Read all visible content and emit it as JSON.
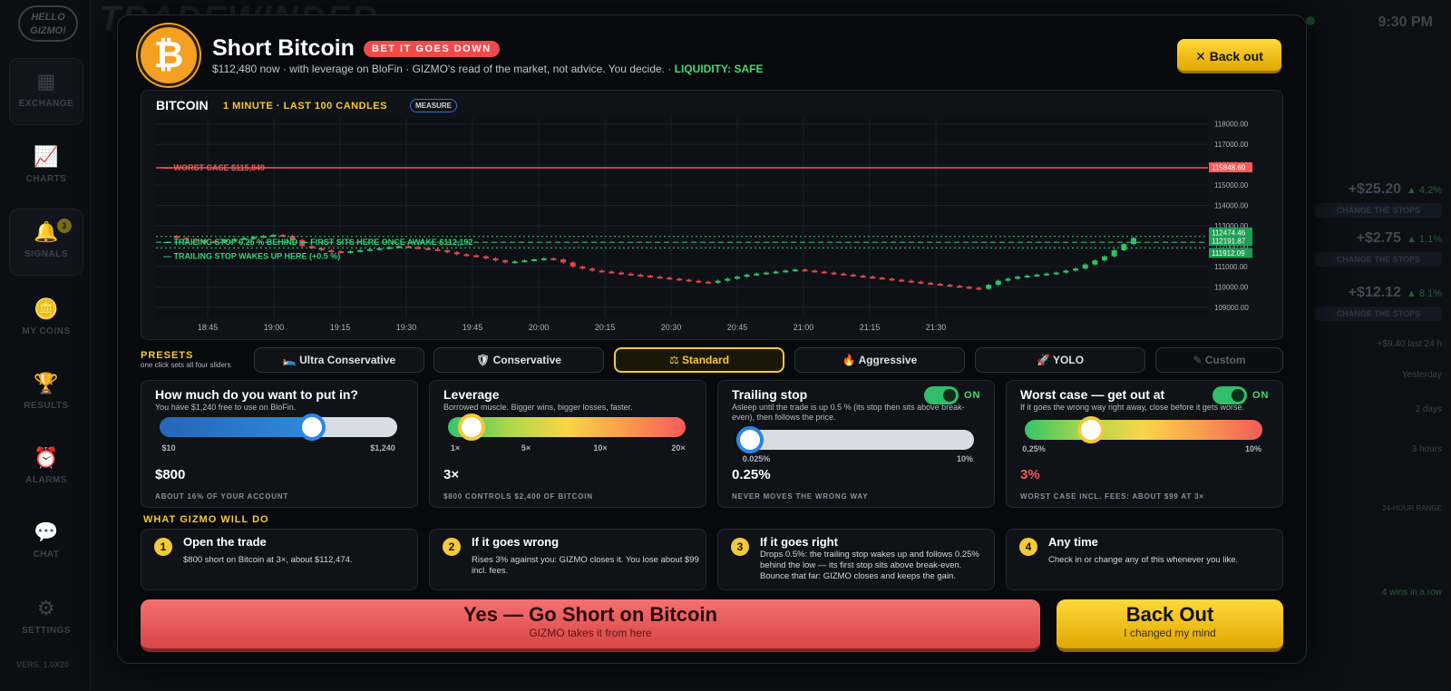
{
  "app": {
    "logo_text": "HELLO GIZMO!",
    "brand_text": "TRADEWINDER",
    "clock": "9:30 PM",
    "version": "VERS. 1.0X20",
    "nav": [
      {
        "label": "EXCHANGE",
        "icon": "exchange-icon"
      },
      {
        "label": "CHARTS",
        "icon": "chart-icon"
      },
      {
        "label": "SIGNALS",
        "icon": "bell-icon",
        "badge": "3"
      },
      {
        "label": "MY COINS",
        "icon": "coins-icon"
      },
      {
        "label": "RESULTS",
        "icon": "trophy-icon"
      },
      {
        "label": "ALARMS",
        "icon": "alarm-icon"
      },
      {
        "label": "CHAT",
        "icon": "chat-icon"
      },
      {
        "label": "SETTINGS",
        "icon": "gear-icon"
      }
    ],
    "right_rows": [
      {
        "value": "+$25.20",
        "pct": "▲ 4.2%",
        "btn": "CHANGE THE STOPS"
      },
      {
        "value": "+$2.75",
        "pct": "▲ 1.1%",
        "btn": "CHANGE THE STOPS"
      },
      {
        "value": "+$12.12",
        "pct": "▲ 8.1%",
        "btn": "CHANGE THE STOPS"
      }
    ],
    "right_misc": [
      "+$9.40 last 24 h",
      "Yesterday",
      "2 days",
      "3 hours",
      "24-HOUR RANGE",
      "4 wins in a row"
    ]
  },
  "modal": {
    "title": "Short Bitcoin",
    "tag": "BET IT GOES DOWN",
    "subline": "$112,480 now · with leverage on BloFin · GIZMO's read of the market, not advice. You decide. · ",
    "liquidity": "LIQUIDITY: SAFE",
    "back_out_top": "Back out",
    "coin_symbol": "₿"
  },
  "chart_data": {
    "type": "candlestick",
    "title": "BITCOIN",
    "timeframe": "1 MINUTE · LAST 100 CANDLES",
    "measure_label": "MEASURE",
    "x_ticks": [
      "18:45",
      "19:00",
      "19:15",
      "19:30",
      "19:45",
      "20:00",
      "20:15",
      "20:30",
      "20:45",
      "21:00",
      "21:15",
      "21:30"
    ],
    "y_ticks": [
      118000,
      117000,
      116000,
      115000,
      114000,
      113000,
      112000,
      111000,
      110000,
      109000
    ],
    "y_tick_labels": [
      "118000.00",
      "117000.00",
      "116000.00",
      "115000.00",
      "114000.00",
      "113000.00",
      "112000.00",
      "111000.00",
      "110000.00",
      "109000.00"
    ],
    "ylim": [
      108500,
      118300
    ],
    "grid": true,
    "close_prices": [
      112500,
      112400,
      112350,
      112300,
      112250,
      112200,
      112300,
      112350,
      112400,
      112450,
      112500,
      112550,
      112500,
      112300,
      112000,
      111900,
      111800,
      111750,
      111700,
      111750,
      111800,
      111850,
      111900,
      111950,
      112000,
      111950,
      111900,
      111850,
      111800,
      111700,
      111600,
      111550,
      111500,
      111400,
      111300,
      111200,
      111250,
      111300,
      111350,
      111400,
      111350,
      111200,
      111000,
      110900,
      110800,
      110750,
      110700,
      110650,
      110600,
      110550,
      110500,
      110450,
      110400,
      110350,
      110300,
      110250,
      110200,
      110300,
      110400,
      110500,
      110600,
      110650,
      110700,
      110750,
      110800,
      110850,
      110800,
      110750,
      110700,
      110650,
      110600,
      110550,
      110500,
      110450,
      110400,
      110350,
      110300,
      110250,
      110200,
      110150,
      110100,
      110050,
      110000,
      109950,
      109900,
      110100,
      110300,
      110400,
      110500,
      110550,
      110600,
      110650,
      110700,
      110800,
      110900,
      111100,
      111300,
      111500,
      111800,
      112100,
      112400
    ],
    "lines": [
      {
        "label": "WORST CASE $115,849",
        "value": 115848.69,
        "tag": "115848.69",
        "color": "#f25b5b",
        "style": "solid"
      },
      {
        "label": "TRAILING STOP 0.25 % BEHIND — FIRST SITS HERE ONCE AWAKE $112,192",
        "value": 112191.87,
        "tag": "112191.87",
        "color": "#34d17a",
        "style": "dashed"
      },
      {
        "label": "TRAILING STOP WAKES UP HERE (+0.5 %)",
        "value": 111912.09,
        "tag": "111912.09",
        "color": "#34d17a",
        "style": "dotted"
      },
      {
        "label": "",
        "value": 112474.46,
        "tag": "112474.46",
        "color": "#34d17a",
        "style": "dotted"
      }
    ]
  },
  "presets": {
    "label": "PRESETS",
    "sub": "one click sets all four sliders",
    "items": [
      {
        "label": "Ultra Conservative",
        "icon": "🛌"
      },
      {
        "label": "Conservative",
        "icon": "🛡"
      },
      {
        "label": "Standard",
        "icon": "⚖"
      },
      {
        "label": "Aggressive",
        "icon": "🔥"
      },
      {
        "label": "YOLO",
        "icon": "🚀"
      },
      {
        "label": "Custom",
        "icon": "✎"
      }
    ]
  },
  "cards": {
    "amount": {
      "title": "How much do you want to put in?",
      "sub": "You have $1,240 free to use on BloFin.",
      "min": "$10",
      "max": "$1,240",
      "level_percent": 64,
      "value": "$800",
      "foot": "ABOUT 16% OF YOUR ACCOUNT"
    },
    "leverage": {
      "title": "Leverage",
      "sub": "Borrowed muscle. Bigger wins, bigger losses, faster.",
      "ticks": [
        "1×",
        "5×",
        "10×",
        "20×"
      ],
      "level_percent": 10,
      "value": "3×",
      "foot": "$800 CONTROLS $2,400 OF BITCOIN"
    },
    "trailing": {
      "title": "Trailing stop",
      "toggle": "ON",
      "sub": "Asleep until the trade is up 0.5 % (its stop then sits above break-even), then follows the price.",
      "min": "0.025%",
      "max": "10%",
      "level_percent": 0,
      "value": "0.25%",
      "foot": "NEVER MOVES THE WRONG WAY"
    },
    "worst": {
      "title": "Worst case — get out at",
      "toggle": "ON",
      "sub": "If it goes the wrong way right away, close before it gets worse.",
      "min": "0.25%",
      "max": "10%",
      "level_percent": 28,
      "value": "3%",
      "value_color": "#f25b5b",
      "foot": "WORST CASE INCL. FEES: ABOUT $99 AT 3×"
    }
  },
  "steps": {
    "label": "WHAT GIZMO WILL DO",
    "items": [
      {
        "num": "1",
        "title": "Open the trade",
        "text": "$800 short on Bitcoin at 3×, about $112,474."
      },
      {
        "num": "2",
        "title": "If it goes wrong",
        "text": "Rises 3% against you: GIZMO closes it. You lose about $99 incl. fees."
      },
      {
        "num": "3",
        "title": "If it goes right",
        "text": "Drops 0.5%: the trailing stop wakes up and follows 0.25% behind the low — its first stop sits above break-even. Bounce that far: GIZMO closes and keeps the gain."
      },
      {
        "num": "4",
        "title": "Any time",
        "text": "Check in or change any of this whenever you like."
      }
    ]
  },
  "actions": {
    "go_label": "Yes — Go Short on Bitcoin",
    "go_sub": "GIZMO takes it from here",
    "back_label": "Back Out",
    "back_sub": "I changed my mind"
  }
}
